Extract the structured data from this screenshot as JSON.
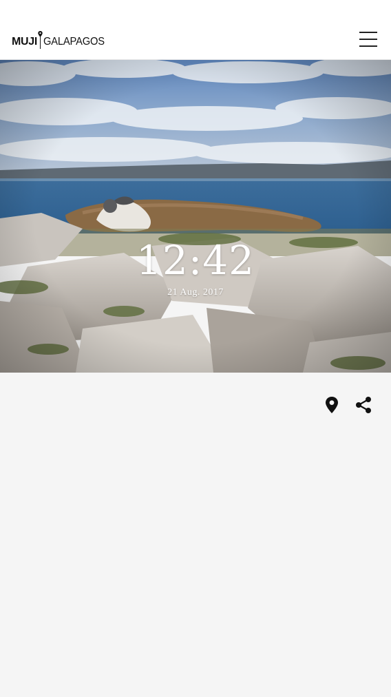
{
  "header": {
    "logo_brand": "MUJI",
    "logo_place": "GALAPAGOS",
    "menu_icon": "hamburger-menu-icon"
  },
  "hero": {
    "time": "12:42",
    "date": "21 Aug. 2017"
  },
  "actions": {
    "location_icon": "map-pin-icon",
    "share_icon": "share-icon"
  },
  "colors": {
    "page_background": "#f5f5f5",
    "header_background": "#ffffff",
    "icon_color": "#111111",
    "overlay_text": "#ffffff"
  }
}
